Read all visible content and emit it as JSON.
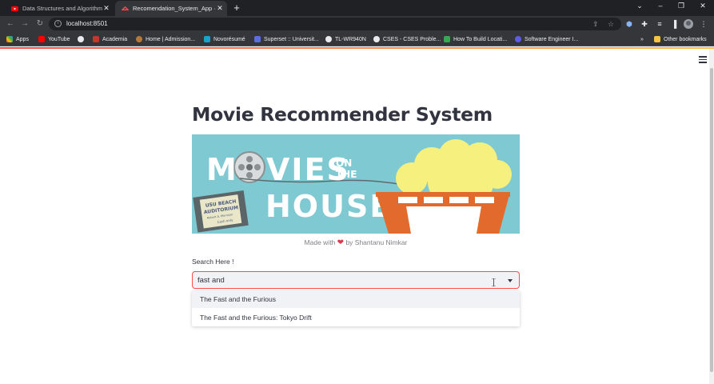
{
  "browser": {
    "tabs": [
      {
        "label": "Data Structures and Algorithms in",
        "active": false
      },
      {
        "label": "Recomendation_System_App · St",
        "active": true
      }
    ],
    "url": "localhost:8501",
    "bookmarks": [
      "Apps",
      "YouTube",
      "",
      "Academia",
      "Home | Admission...",
      "Novorésumé",
      "Superset :: Universit...",
      "TL-WR940N",
      "CSES - CSES Proble...",
      "How To Build Locati...",
      "Software Engineer I..."
    ],
    "other_bookmarks": "Other bookmarks",
    "more_bookmarks": "»"
  },
  "app": {
    "title": "Movie Recommender System",
    "banner": {
      "line1_left": "M",
      "line1_right": "VIES",
      "on": "ON",
      "the": "THE",
      "house": "HOUSE",
      "ticket_lines": [
        "USU BEACH",
        "AUDITORIUM",
        "Robert A. Morrison",
        "Cash only"
      ],
      "colors": {
        "background": "#7ec9d2",
        "popcorn": "#f6f07e",
        "bucket": "#e26a2c"
      }
    },
    "caption_pre": "Made with",
    "caption_post": "by Shantanu Nimkar",
    "search_label": "Search Here !",
    "search_value": "fast and",
    "options": [
      "The Fast and the Furious",
      "The Fast and the Furious: Tokyo Drift"
    ],
    "highlighted_option": 0,
    "accent": "#ff4b4b"
  }
}
